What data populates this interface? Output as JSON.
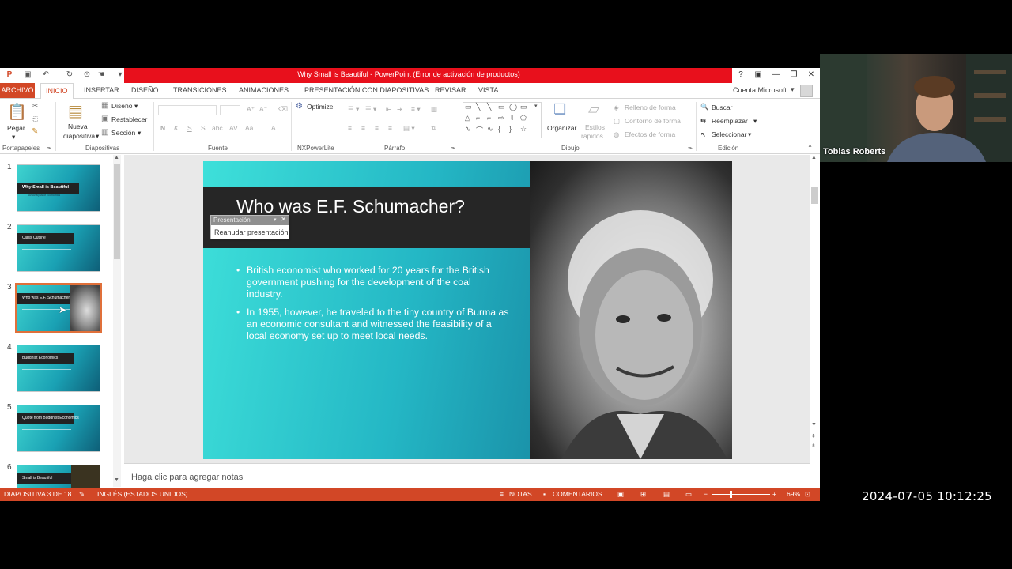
{
  "window": {
    "title": "Why Small is Beautiful - PowerPoint (Error de activación de productos)",
    "controls": [
      "?",
      "▣",
      "—",
      "❐",
      "✕"
    ]
  },
  "tabs": [
    "ARCHIVO",
    "INICIO",
    "INSERTAR",
    "DISEÑO",
    "TRANSICIONES",
    "ANIMACIONES",
    "PRESENTACIÓN CON DIAPOSITIVAS",
    "REVISAR",
    "VISTA"
  ],
  "account": "Cuenta Microsoft",
  "ribbon": {
    "clipboard": {
      "paste": "Pegar",
      "label": "Portapapeles"
    },
    "slides": {
      "new_slide_1": "Nueva",
      "new_slide_2": "diapositiva",
      "layout": "Diseño",
      "reset": "Restablecer",
      "section": "Sección",
      "label": "Diapositivas"
    },
    "font": {
      "bold": "N",
      "italic": "K",
      "underline": "S",
      "strike": "S",
      "label": "Fuente"
    },
    "nxpowerlite": {
      "optimize": "Optimize",
      "label": "NXPowerLite"
    },
    "paragraph": {
      "label": "Párrafo"
    },
    "drawing": {
      "arrange": "Organizar",
      "styles_1": "Estilos",
      "styles_2": "rápidos",
      "fill": "Relleno de forma",
      "outline": "Contorno de forma",
      "effects": "Efectos de forma",
      "label": "Dibujo"
    },
    "editing": {
      "find": "Buscar",
      "replace": "Reemplazar",
      "select": "Seleccionar",
      "label": "Edición"
    }
  },
  "thumbnails": [
    {
      "num": "1",
      "title": "Why Small is Beautiful",
      "subtitle": "An Analysis of Economics"
    },
    {
      "num": "2",
      "title": "Class Outline"
    },
    {
      "num": "3",
      "title": "Who was E.F. Schumacher?"
    },
    {
      "num": "4",
      "title": "Buddhist Economics"
    },
    {
      "num": "5",
      "title": "Quote from Buddhist Economics"
    },
    {
      "num": "6",
      "title": "Small is Beautiful"
    }
  ],
  "popup": {
    "title": "Presentación",
    "item": "Reanudar presentación"
  },
  "slide": {
    "title": "Who was E.F. Schumacher?",
    "bullets": [
      "British economist who worked for 20 years for the British government pushing for the development of the coal industry.",
      "In 1955, however, he traveled to the tiny country of Burma as an economic consultant and witnessed the feasibility of a local economy set up to meet local needs."
    ]
  },
  "notes_placeholder": "Haga clic para agregar notas",
  "status": {
    "slide_of": "DIAPOSITIVA 3 DE 18",
    "language": "INGLÉS (ESTADOS UNIDOS)",
    "notes": "NOTAS",
    "comments": "COMENTARIOS",
    "zoom": "69%"
  },
  "webcam": {
    "name": "Tobias Roberts"
  },
  "timestamp": "2024-07-05  10:12:25",
  "colors": {
    "accent": "#d24726",
    "titlebar_red": "#e8101c",
    "slide_teal": "#24b7c5"
  }
}
